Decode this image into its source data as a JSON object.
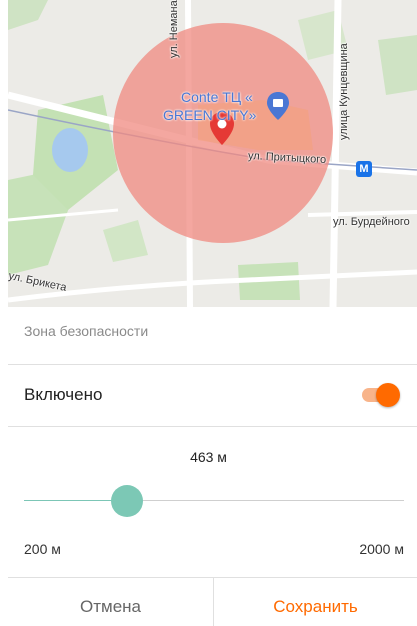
{
  "map": {
    "poi_line1": "Conte ТЦ «",
    "poi_line2": "GREEN CITY»",
    "streets": {
      "nemana": "ул. Немана",
      "kuntsevshchina": "улица Кунцевщина",
      "pritytskogo": "ул. Притыцкого",
      "burdeynogo": "ул. Бурдейного",
      "briketa": "ул. Брикета"
    },
    "metro_letter": "M"
  },
  "safety_zone": {
    "section_title": "Зона безопасности",
    "enabled_label": "Включено",
    "enabled": true,
    "radius_value": "463 м",
    "radius_meters": 463,
    "min_label": "200 м",
    "max_label": "2000 м",
    "min_meters": 200,
    "max_meters": 2000
  },
  "actions": {
    "cancel_label": "Отмена",
    "save_label": "Сохранить"
  },
  "colors": {
    "accent": "#ff6a00",
    "slider_thumb": "#7cc8b5",
    "zone_fill": "#f08a80",
    "pin": "#e53935"
  }
}
